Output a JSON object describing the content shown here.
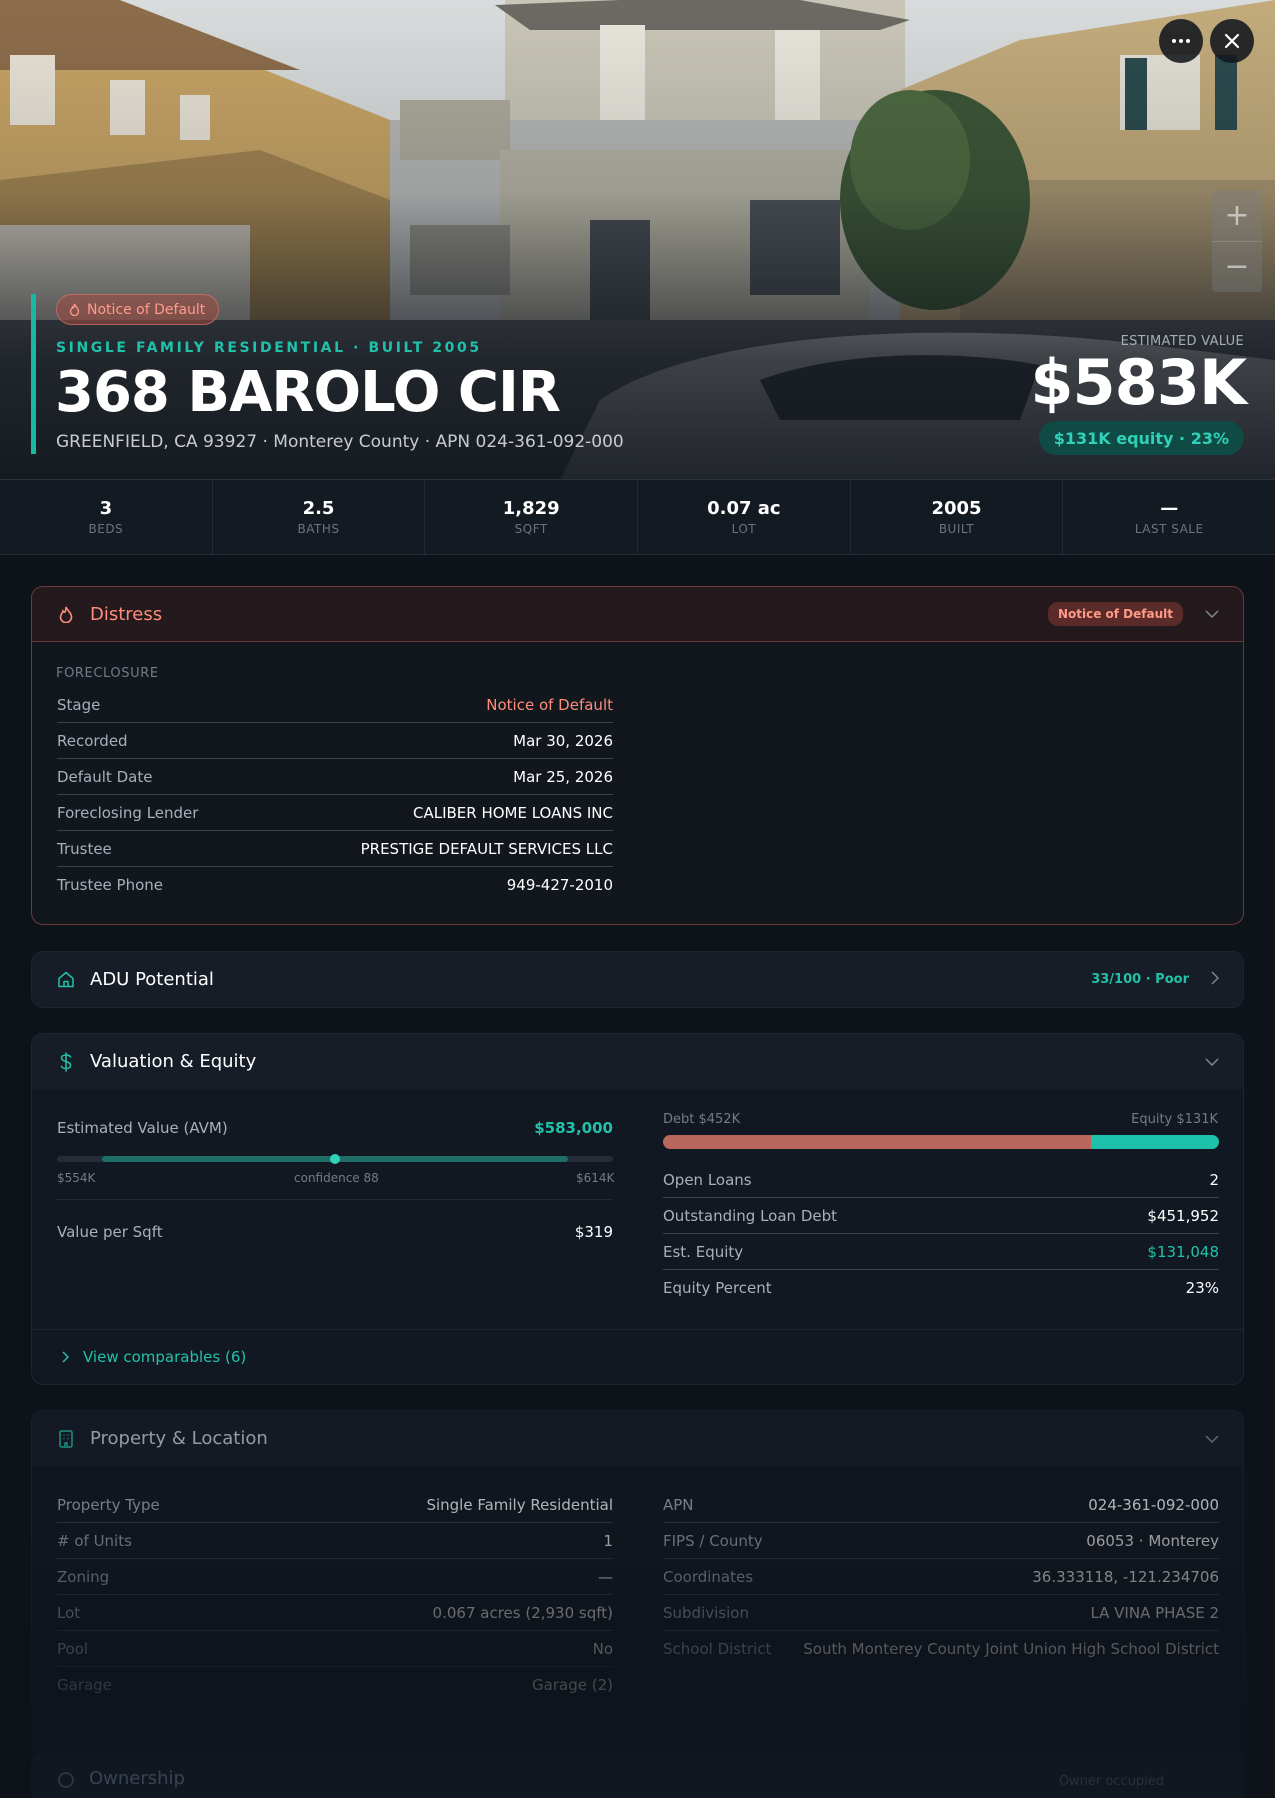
{
  "hero": {
    "badge": "Notice of Default",
    "subtitle": "SINGLE FAMILY RESIDENTIAL · BUILT 2005",
    "address": "368 BAROLO CIR",
    "location": "GREENFIELD, CA 93927 · Monterey County · APN 024-361-092-000",
    "estimated_value_label": "ESTIMATED VALUE",
    "estimated_value": "$583K",
    "equity_pill": "$131K equity · 23%",
    "more_icon": "more-horizontal-icon",
    "close_icon": "close-icon",
    "zoom_in": "+",
    "zoom_out": "−"
  },
  "stats": [
    {
      "value": "3",
      "label": "BEDS"
    },
    {
      "value": "2.5",
      "label": "BATHS"
    },
    {
      "value": "1,829",
      "label": "SQFT"
    },
    {
      "value": "0.07 ac",
      "label": "LOT"
    },
    {
      "value": "2005",
      "label": "BUILT"
    },
    {
      "value": "—",
      "label": "LAST SALE"
    }
  ],
  "distress": {
    "title": "Distress",
    "badge": "Notice of Default",
    "section": "FORECLOSURE",
    "rows": [
      {
        "k": "Stage",
        "v": "Notice of Default"
      },
      {
        "k": "Recorded",
        "v": "Mar 30, 2026"
      },
      {
        "k": "Default Date",
        "v": "Mar 25, 2026"
      },
      {
        "k": "Foreclosing Lender",
        "v": "CALIBER HOME LOANS INC"
      },
      {
        "k": "Trustee",
        "v": "PRESTIGE DEFAULT SERVICES LLC"
      },
      {
        "k": "Trustee Phone",
        "v": "949-427-2010"
      }
    ]
  },
  "adu": {
    "title": "ADU Potential",
    "score": "33/100 · Poor"
  },
  "valuation": {
    "title": "Valuation & Equity",
    "avm_label": "Estimated Value (AVM)",
    "avm_value": "$583,000",
    "range_low": "$554K",
    "range_high": "$614K",
    "confidence": "confidence 88",
    "per_sqft_label": "Value per Sqft",
    "per_sqft_value": "$319",
    "debt_label": "Debt $452K",
    "equity_label": "Equity $131K",
    "equity_share": 0.23,
    "rows": [
      {
        "k": "Open Loans",
        "v": "2"
      },
      {
        "k": "Outstanding Loan Debt",
        "v": "$451,952"
      },
      {
        "k": "Est. Equity",
        "v": "$131,048"
      },
      {
        "k": "Equity Percent",
        "v": "23%"
      }
    ],
    "comparables_link": "View comparables (6)"
  },
  "property": {
    "title": "Property & Location",
    "left": [
      {
        "k": "Property Type",
        "v": "Single Family Residential"
      },
      {
        "k": "# of Units",
        "v": "1"
      },
      {
        "k": "Zoning",
        "v": "—"
      },
      {
        "k": "Lot",
        "v": "0.067 acres (2,930 sqft)"
      },
      {
        "k": "Pool",
        "v": "No"
      },
      {
        "k": "Garage",
        "v": "Garage (2)"
      }
    ],
    "right": [
      {
        "k": "APN",
        "v": "024-361-092-000"
      },
      {
        "k": "FIPS / County",
        "v": "06053 · Monterey"
      },
      {
        "k": "Coordinates",
        "v": "36.333118, -121.234706"
      },
      {
        "k": "Subdivision",
        "v": "LA VINA PHASE 2"
      },
      {
        "k": "School District",
        "v": "South Monterey County Joint Union High School District"
      }
    ]
  },
  "ownership": {
    "title": "Ownership",
    "right": "Owner occupied"
  },
  "colors": {
    "accent": "#19b8a2",
    "distress": "#ff8d7b",
    "debt": "#b9665c",
    "equity": "#1ec2aa",
    "background": "#0e131a"
  }
}
